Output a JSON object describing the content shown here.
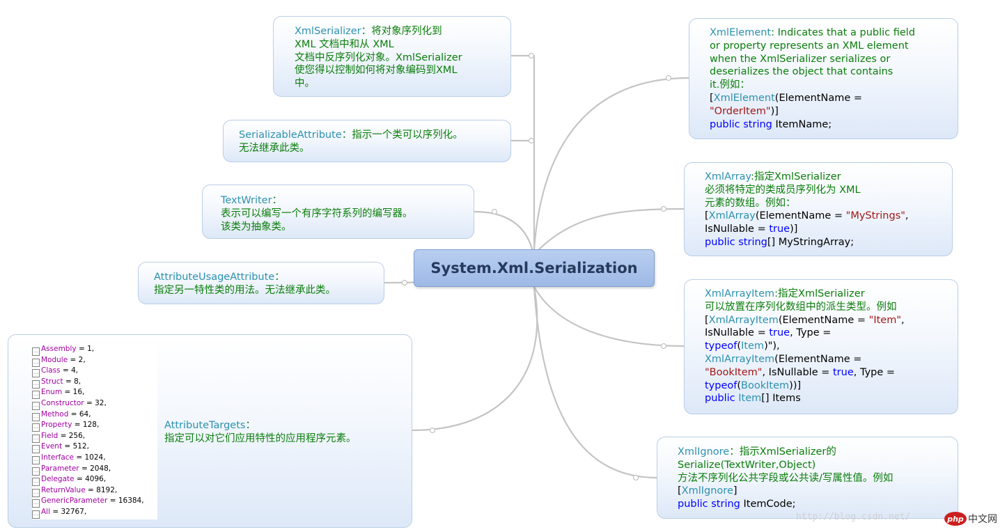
{
  "center": {
    "title": "System.Xml.Serialization"
  },
  "nodes": {
    "xmlserializer": {
      "lines": [
        [
          [
            "t",
            "XmlSerializer"
          ],
          [
            "g",
            "：将对象序列化到"
          ]
        ],
        [
          [
            "g",
            "XML 文档中和从 XML"
          ]
        ],
        [
          [
            "g",
            "文档中反序列化对象。XmlSerializer"
          ]
        ],
        [
          [
            "g",
            "使您得以控制如何将对象编码到XML"
          ]
        ],
        [
          [
            "g",
            "中。"
          ]
        ]
      ]
    },
    "serializable": {
      "lines": [
        [
          [
            "t",
            "SerializableAttribute"
          ],
          [
            "g",
            "：指示一个类可以序列化。"
          ]
        ],
        [
          [
            "g",
            "无法继承此类。"
          ]
        ]
      ]
    },
    "textwriter": {
      "lines": [
        [
          [
            "t",
            "TextWriter"
          ],
          [
            "g",
            "："
          ]
        ],
        [
          [
            "g",
            "表示可以编写一个有序字符系列的编写器。"
          ]
        ],
        [
          [
            "g",
            "该类为抽象类。"
          ]
        ]
      ]
    },
    "attributeusage": {
      "lines": [
        [
          [
            "t",
            "AttributeUsageAttribute"
          ],
          [
            "g",
            "："
          ]
        ],
        [
          [
            "g",
            "指定另一特性类的用法。无法继承此类。"
          ]
        ]
      ]
    },
    "attributetargets": {
      "lines": [
        [
          [
            "t",
            "AttributeTargets"
          ],
          [
            "g",
            "："
          ]
        ],
        [
          [
            "g",
            "指定可以对它们应用特性的应用程序元素。"
          ]
        ]
      ],
      "enum_box_glyph": "…",
      "enum": [
        {
          "name": "Assembly",
          "rest": " = 1,"
        },
        {
          "name": "Module",
          "rest": " = 2,"
        },
        {
          "name": "Class",
          "rest": " = 4,"
        },
        {
          "name": "Struct",
          "rest": " = 8,"
        },
        {
          "name": "Enum",
          "rest": " = 16,"
        },
        {
          "name": "Constructor",
          "rest": " = 32,"
        },
        {
          "name": "Method",
          "rest": " = 64,"
        },
        {
          "name": "Property",
          "rest": " = 128,"
        },
        {
          "name": "Field",
          "rest": " = 256,"
        },
        {
          "name": "Event",
          "rest": " = 512,"
        },
        {
          "name": "Interface",
          "rest": " = 1024,"
        },
        {
          "name": "Parameter",
          "rest": " = 2048,"
        },
        {
          "name": "Delegate",
          "rest": " = 4096,"
        },
        {
          "name": "ReturnValue",
          "rest": " = 8192,"
        },
        {
          "name": "GenericParameter",
          "rest": " = 16384,"
        },
        {
          "name": "All",
          "rest": " = 32767,"
        }
      ]
    },
    "xmlelement": {
      "lines": [
        [
          [
            "t",
            "XmlElement"
          ],
          [
            "g",
            ": Indicates that a public field"
          ]
        ],
        [
          [
            "g",
            "or property represents an XML element"
          ]
        ],
        [
          [
            "g",
            "when the XmlSerializer serializes or"
          ]
        ],
        [
          [
            "g",
            "deserializes the object that contains"
          ]
        ],
        [
          [
            "g",
            "it.例如："
          ]
        ],
        [
          [
            "b",
            "["
          ],
          [
            "t",
            "XmlElement"
          ],
          [
            "b",
            "(ElementName ="
          ]
        ],
        [
          [
            "s",
            "\"OrderItem\""
          ],
          [
            "b",
            ")]"
          ]
        ],
        [
          [
            "k",
            "public"
          ],
          [
            "b",
            " "
          ],
          [
            "k",
            "string"
          ],
          [
            "b",
            " ItemName;"
          ]
        ]
      ]
    },
    "xmlarray": {
      "lines": [
        [
          [
            "t",
            "XmlArray"
          ],
          [
            "g",
            ":指定XmlSerializer"
          ]
        ],
        [
          [
            "g",
            "必须将特定的类成员序列化为 XML"
          ]
        ],
        [
          [
            "g",
            "元素的数组。例如："
          ]
        ],
        [
          [
            "b",
            "["
          ],
          [
            "t",
            "XmlArray"
          ],
          [
            "b",
            "(ElementName = "
          ],
          [
            "s",
            "\"MyStrings\""
          ],
          [
            "b",
            ","
          ]
        ],
        [
          [
            "b",
            "IsNullable = "
          ],
          [
            "k",
            "true"
          ],
          [
            "b",
            ")]"
          ]
        ],
        [
          [
            "k",
            "public"
          ],
          [
            "b",
            " "
          ],
          [
            "k",
            "string"
          ],
          [
            "b",
            "[] MyStringArray;"
          ]
        ]
      ]
    },
    "xmlarrayitem": {
      "lines": [
        [
          [
            "t",
            "XmlArrayItem"
          ],
          [
            "g",
            ":指定XmlSerializer"
          ]
        ],
        [
          [
            "g",
            "可以放置在序列化数组中的派生类型。例如"
          ]
        ],
        [
          [
            "b",
            "["
          ],
          [
            "t",
            "XmlArrayItem"
          ],
          [
            "b",
            "(ElementName = "
          ],
          [
            "s",
            "\"Item\""
          ],
          [
            "b",
            ","
          ]
        ],
        [
          [
            "b",
            "IsNullable = "
          ],
          [
            "k",
            "true"
          ],
          [
            "b",
            ", Type ="
          ]
        ],
        [
          [
            "k",
            "typeof"
          ],
          [
            "b",
            "("
          ],
          [
            "t",
            "Item"
          ],
          [
            "b",
            ")\"),"
          ]
        ],
        [
          [
            "b",
            " "
          ],
          [
            "t",
            "XmlArrayItem"
          ],
          [
            "b",
            "(ElementName ="
          ]
        ],
        [
          [
            "s",
            "\"BookItem\""
          ],
          [
            "b",
            ", IsNullable = "
          ],
          [
            "k",
            "true"
          ],
          [
            "b",
            ", Type ="
          ]
        ],
        [
          [
            "k",
            "typeof"
          ],
          [
            "b",
            "("
          ],
          [
            "t",
            "BookItem"
          ],
          [
            "b",
            "))]"
          ]
        ],
        [
          [
            "k",
            "public"
          ],
          [
            "b",
            " "
          ],
          [
            "t",
            "Item"
          ],
          [
            "b",
            "[] Items"
          ]
        ]
      ]
    },
    "xmlignore": {
      "lines": [
        [
          [
            "t",
            "XmlIgnore"
          ],
          [
            "g",
            "：指示XmlSerializer的"
          ]
        ],
        [
          [
            "g",
            "Serialize(TextWriter,Object)"
          ]
        ],
        [
          [
            "g",
            "方法不序列化公共字段或公共读/写属性值。例如"
          ]
        ],
        [
          [
            "b",
            "["
          ],
          [
            "t",
            "XmlIgnore"
          ],
          [
            "b",
            "]"
          ]
        ],
        [
          [
            "k",
            "public"
          ],
          [
            "b",
            " "
          ],
          [
            "k",
            "string"
          ],
          [
            "b",
            " ItemCode;"
          ]
        ]
      ]
    }
  },
  "watermark": "http://blog.csdn.net/",
  "logo": {
    "mark": "php",
    "text": "中文网"
  },
  "colors": {
    "type": "#2b91af",
    "green": "#0a7d0a",
    "keyword": "#0000ff",
    "string": "#a31515",
    "enum_name": "#a000a0"
  }
}
